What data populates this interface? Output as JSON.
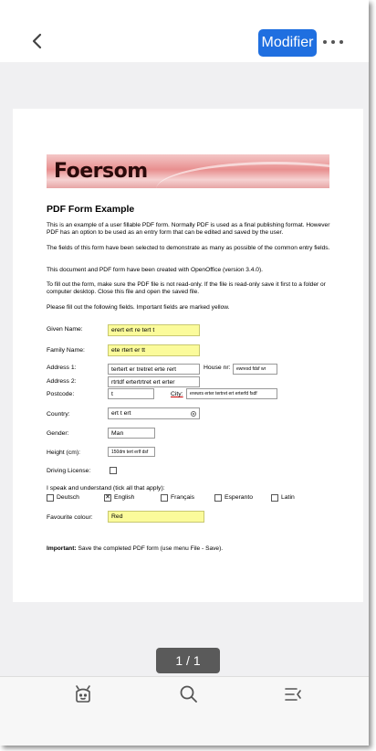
{
  "header": {
    "modify_label": "Modifier"
  },
  "document": {
    "logo_text": "Foersom",
    "title": "PDF Form Example",
    "paragraphs": [
      "This is an example of a user fillable PDF form. Normally PDF is used as a final publishing format. However PDF has an option to be used as an entry form that can be edited and saved by the user.",
      "The fields of this form have been selected to demonstrate as many as possible of the common entry fields.",
      "This document and PDF form have been created with OpenOffice (version 3.4.0).",
      "To fill out the form, make sure the PDF file is not read-only. If the file is read-only save it first to a folder or computer desktop. Close this file and open the saved file.",
      "Please fill out the following fields. Important fields are marked yellow."
    ],
    "form": {
      "given_name_label": "Given Name:",
      "given_name_value": "erert ert re tert t",
      "family_name_label": "Family Name:",
      "family_name_value": "ete rtert er tt",
      "address1_label": "Address 1:",
      "address1_value": "tertert er tretret  erte rert",
      "house_nr_label": "House nr:",
      "house_nr_value": "ewresd fdsf wr",
      "address2_label": "Address 2:",
      "address2_value": "rtrtdf ertertrtret ert erter",
      "postcode_label": "Postcode:",
      "postcode_value": "t",
      "city_label": "City:",
      "city_value": "erewrs erter tertret ert erterfd fsdf",
      "country_label": "Country:",
      "country_value": "ert t ert",
      "gender_label": "Gender:",
      "gender_value": "Man",
      "height_label": "Height (cm):",
      "height_value": "150dm tert erlf dsf",
      "driving_license_label": "Driving License:",
      "languages_label": "I speak and understand (tick all that apply):",
      "languages": [
        {
          "label": "Deutsch",
          "checked": false
        },
        {
          "label": "English",
          "checked": true
        },
        {
          "label": "Français",
          "checked": false
        },
        {
          "label": "Esperanto",
          "checked": false
        },
        {
          "label": "Latin",
          "checked": false
        }
      ],
      "favourite_colour_label": "Favourite colour:",
      "favourite_colour_value": "Red"
    },
    "important_label": "Important:",
    "important_text": " Save the completed PDF form (use menu File - Save)."
  },
  "page_indicator": "1 / 1",
  "toolbar": {
    "icons": [
      "robot-icon",
      "search-icon",
      "outline-list-icon"
    ]
  },
  "colors": {
    "accent": "#1f6fe0",
    "required_field": "#fbfb9b"
  }
}
